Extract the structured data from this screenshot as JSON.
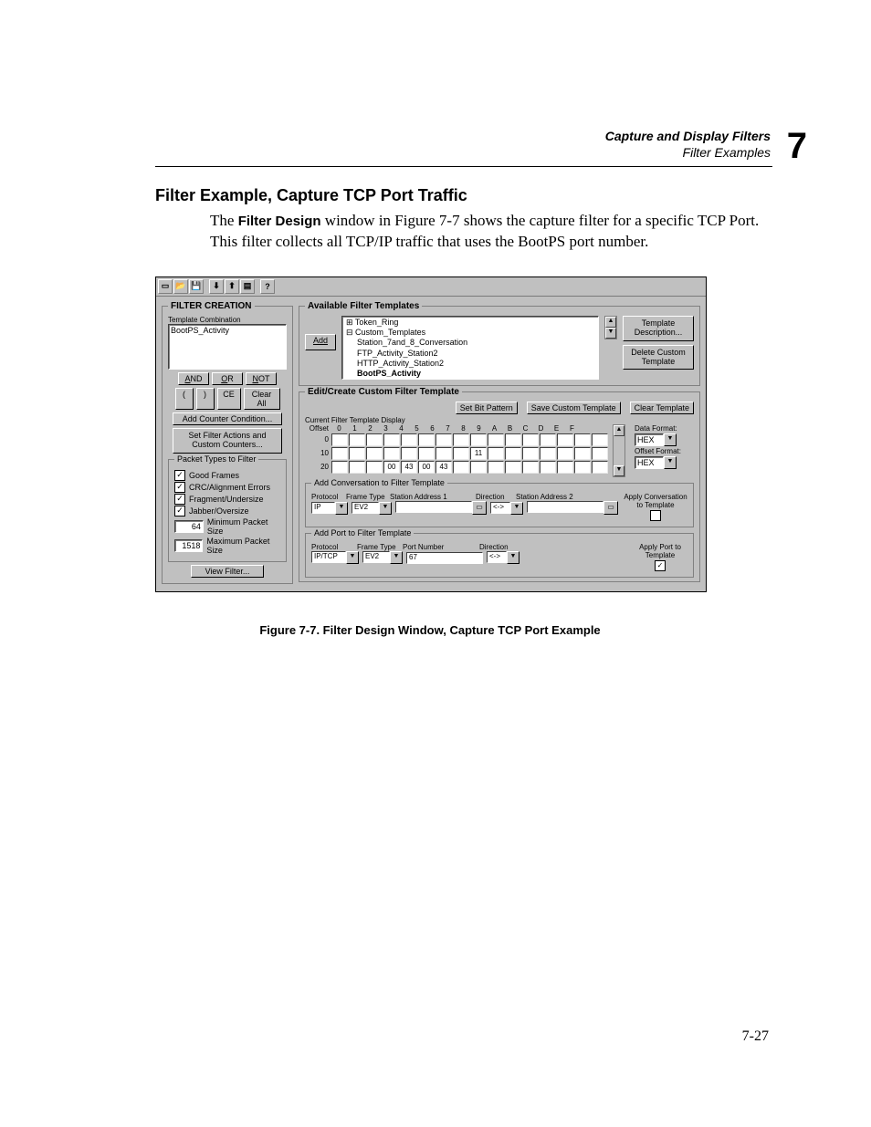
{
  "header": {
    "line1": "Capture and Display Filters",
    "line2": "Filter Examples",
    "chapter": "7"
  },
  "section_title": "Filter Example, Capture TCP Port Traffic",
  "body_prefix": "The ",
  "body_bold": "Filter Design",
  "body_rest": " window in Figure 7-7 shows the capture filter for a specific TCP Port. This filter collects all TCP/IP traffic that uses the BootPS port number.",
  "figure_caption": "Figure 7-7.  Filter Design Window, Capture TCP Port Example",
  "pagenum": "7-27",
  "filter_creation": {
    "box_title": "FILTER CREATION",
    "combo_label": "Template Combination",
    "combo_value": "BootPS_Activity",
    "and": "AND",
    "or": "OR",
    "not": "NOT",
    "lp": "(",
    "rp": ")",
    "ce": "CE",
    "clear": "Clear All",
    "add_counter": "Add Counter Condition...",
    "set_actions": "Set Filter Actions and Custom Counters...",
    "pkt_box": "Packet Types to Filter",
    "good": "Good Frames",
    "crc": "CRC/Alignment Errors",
    "frag": "Fragment/Undersize",
    "jab": "Jabber/Oversize",
    "minv": "64",
    "minl": "Minimum Packet Size",
    "maxv": "1518",
    "maxl": "Maximum Packet Size",
    "view": "View Filter..."
  },
  "available": {
    "box_title": "Available Filter Templates",
    "add": "Add",
    "tree": {
      "token": "Token_Ring",
      "custom": "Custom_Templates",
      "c1": "Station_7and_8_Conversation",
      "c2": "FTP_Activity_Station2",
      "c3": "HTTP_Activity_Station2",
      "c4": "BootPS_Activity"
    },
    "desc": "Template Description...",
    "del": "Delete Custom Template"
  },
  "edit": {
    "box_title": "Edit/Create Custom Filter Template",
    "setbit": "Set Bit Pattern",
    "save": "Save Custom Template",
    "clear": "Clear Template",
    "disp": "Current Filter Template Display",
    "offset": "Offset",
    "hex_cols": [
      "0",
      "1",
      "2",
      "3",
      "4",
      "5",
      "6",
      "7",
      "8",
      "9",
      "A",
      "B",
      "C",
      "D",
      "E",
      "F"
    ],
    "rows": {
      "r0": {
        "label": "0",
        "cells": [
          "",
          "",
          "",
          "",
          "",
          "",
          "",
          "",
          "",
          "",
          "",
          "",
          "",
          "",
          "",
          ""
        ]
      },
      "r10": {
        "label": "10",
        "cells": [
          "",
          "",
          "",
          "",
          "",
          "",
          "",
          "",
          "11",
          "",
          "",
          "",
          "",
          "",
          "",
          ""
        ]
      },
      "r20": {
        "label": "20",
        "cells": [
          "",
          "",
          "",
          "00",
          "43",
          "00",
          "43",
          "",
          "",
          "",
          "",
          "",
          "",
          "",
          "",
          ""
        ]
      }
    },
    "data_format": "Data Format:",
    "offset_format": "Offset Format:",
    "hex": "HEX"
  },
  "conv": {
    "box_title": "Add Conversation to Filter Template",
    "protocol": "Protocol",
    "frame": "Frame Type",
    "sa1": "Station Address 1",
    "dir": "Direction",
    "sa2": "Station Address 2",
    "ip": "IP",
    "ev2": "EV2",
    "arrow": "<->",
    "apply": "Apply Conversation to Template"
  },
  "port": {
    "box_title": "Add Port to Filter Template",
    "protocol": "Protocol",
    "frame": "Frame Type",
    "portnum": "Port Number",
    "dir": "Direction",
    "iptcp": "IP/TCP",
    "ev2": "EV2",
    "val": "67",
    "arrow": "<->",
    "apply": "Apply Port to Template"
  }
}
